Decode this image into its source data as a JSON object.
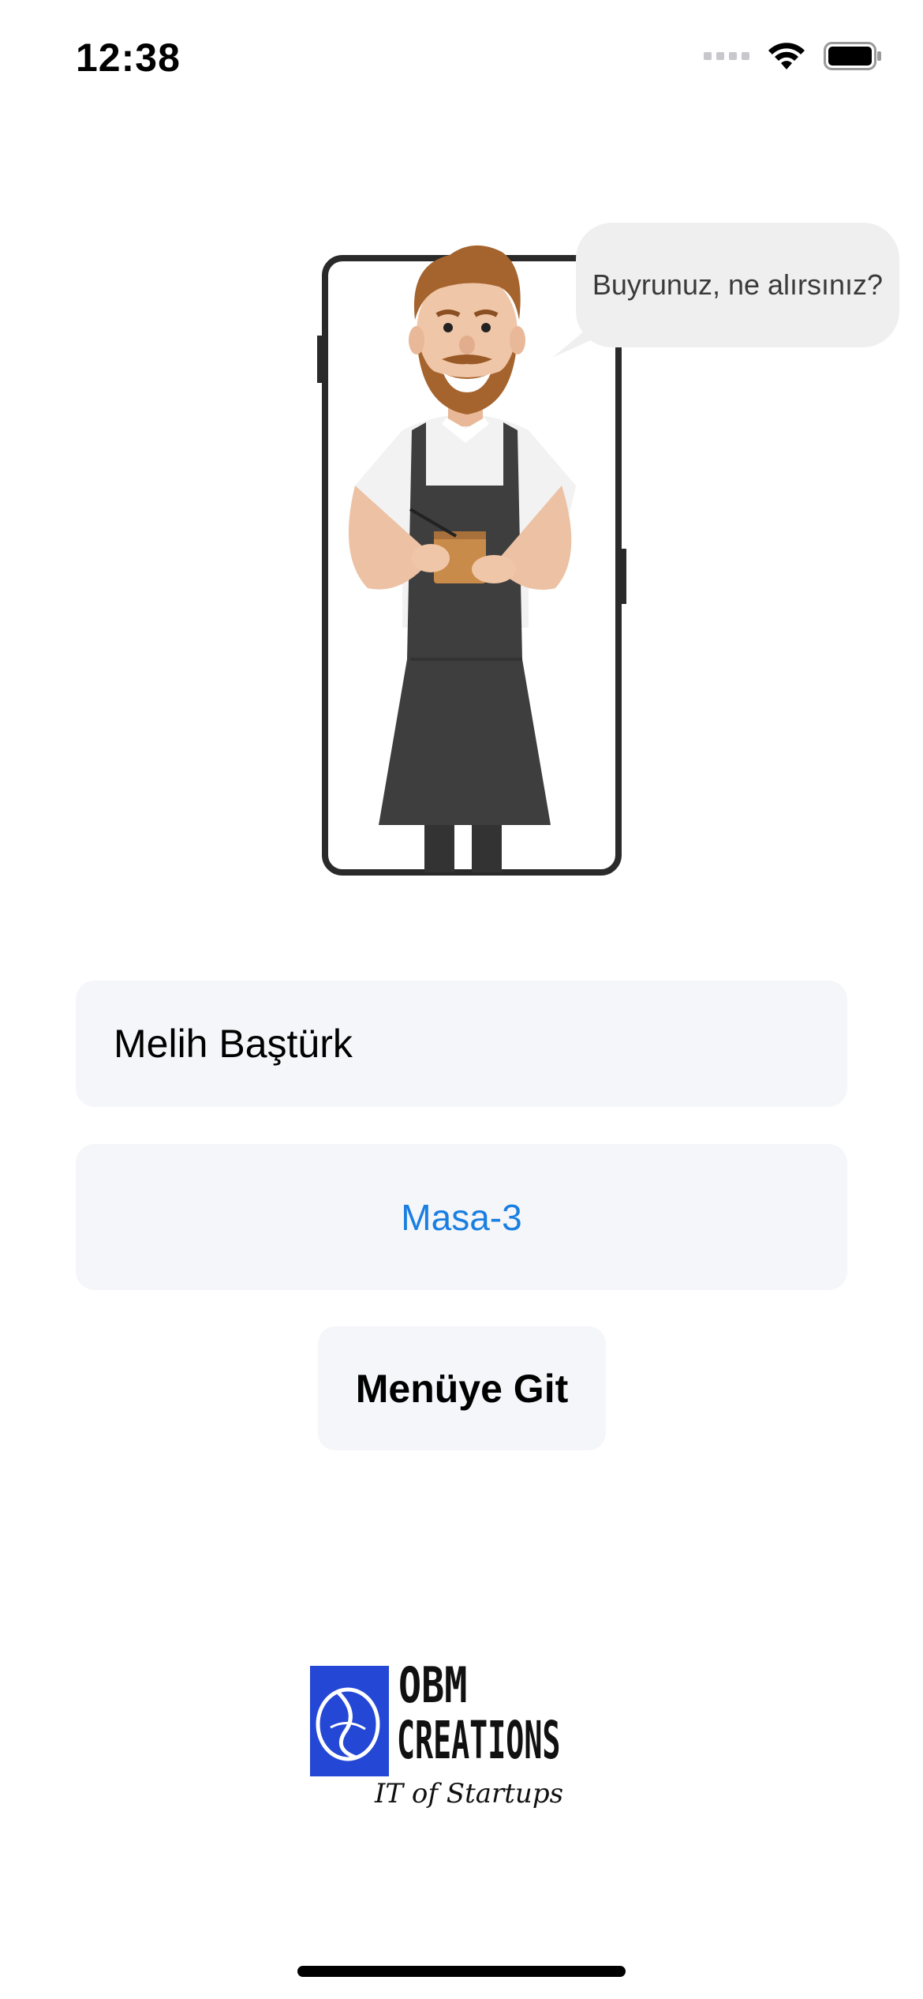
{
  "status_bar": {
    "time": "12:38",
    "icons": [
      "cellular-signal-icon",
      "wifi-icon",
      "battery-icon"
    ]
  },
  "illustration": {
    "speech_bubble": "Buyrunuz, ne alırsınız?"
  },
  "form": {
    "name_value": "Melih Baştürk",
    "table_value": "Masa-3",
    "menu_button_label": "Menüye Git"
  },
  "logo": {
    "line1": "OBM",
    "line2": "CREATIONS",
    "tagline": "IT of Startups",
    "mark_color": "#2447d6"
  },
  "colors": {
    "field_background": "#f5f6fa",
    "link_blue": "#1a7fe0"
  }
}
